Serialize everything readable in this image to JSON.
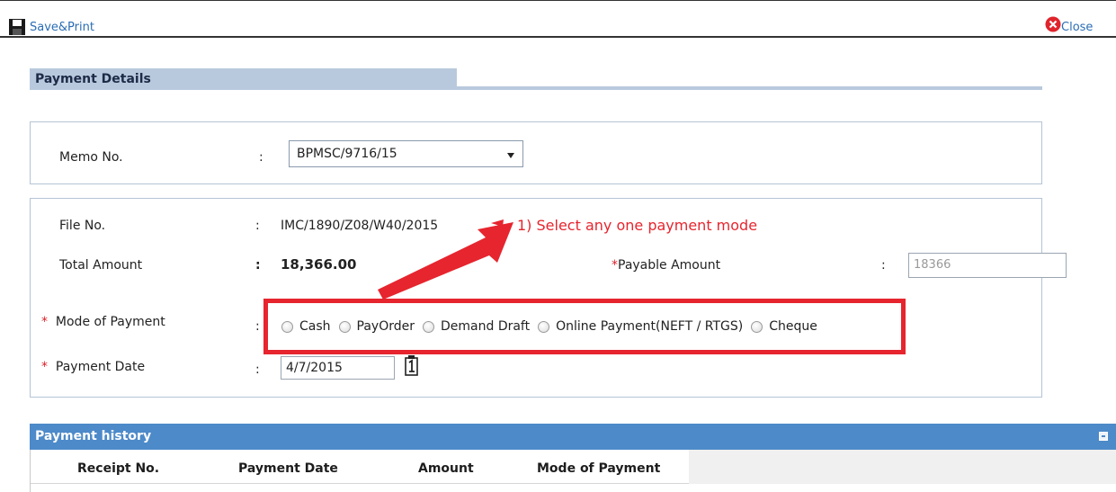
{
  "toolbar": {
    "save_label": "Save&Print",
    "close_label": "Close"
  },
  "section": {
    "title": "Payment Details"
  },
  "memo": {
    "label": "Memo No.",
    "colon": ":",
    "value": "BPMSC/9716/15"
  },
  "details": {
    "file_no_label": "File No.",
    "file_no_value": "IMC/1890/Z08/W40/2015",
    "total_amount_label": "Total Amount",
    "total_amount_value": "18,366.00",
    "payable_required": "*",
    "payable_label": "Payable Amount",
    "payable_value": "18366",
    "mode_required": "*",
    "mode_label": "Mode of Payment",
    "payment_options": [
      "Cash",
      "PayOrder",
      "Demand Draft",
      "Online Payment(NEFT / RTGS)",
      "Cheque"
    ],
    "date_required": "*",
    "date_label": "Payment Date",
    "date_value": "4/7/2015",
    "colon": ":"
  },
  "annotation": {
    "text": "1) Select any one payment mode",
    "color": "#e6252e"
  },
  "history": {
    "title": "Payment history",
    "columns": [
      "Receipt No.",
      "Payment Date",
      "Amount",
      "Mode of Payment"
    ]
  },
  "colors": {
    "header_bar": "#b9c9dd",
    "history_bar": "#4d8ac9",
    "link": "#2a6db5"
  }
}
